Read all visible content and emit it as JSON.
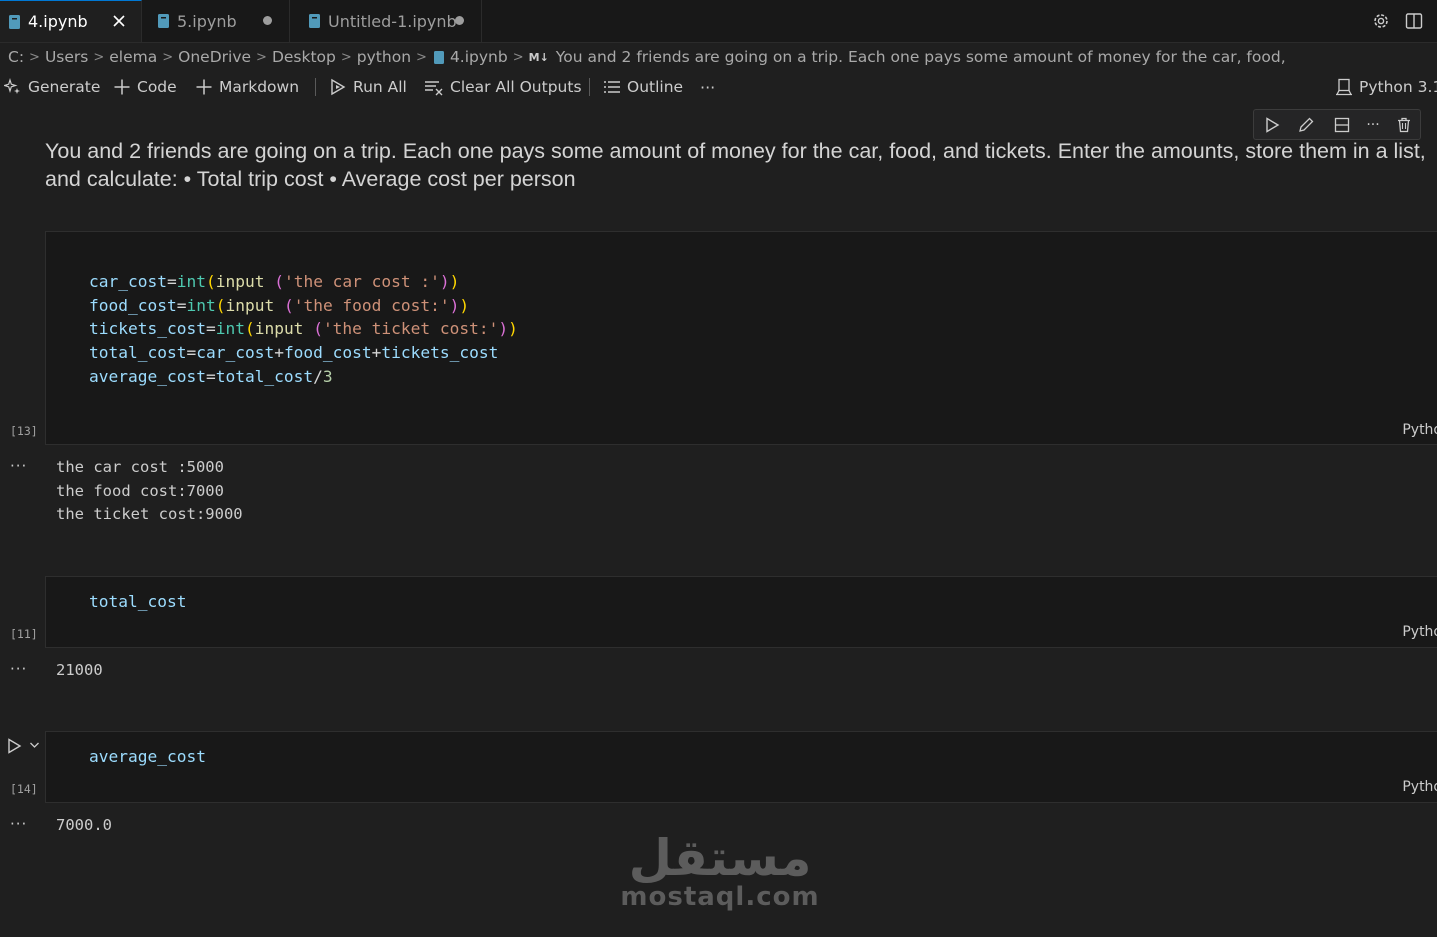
{
  "tabs": [
    {
      "label": "4.ipynb",
      "active": true
    },
    {
      "label": "5.ipynb",
      "dirty": true
    },
    {
      "label": "Untitled-1.ipynb",
      "dirty": true
    }
  ],
  "breadcrumb": [
    "C:",
    "Users",
    "elema",
    "OneDrive",
    "Desktop",
    "python",
    "4.ipynb",
    "You and 2 friends are going on a trip. Each one pays some amount of money for the car, food,"
  ],
  "breadcrumb_md_badge": "M↓",
  "toolbar": {
    "generate": "Generate",
    "code": "Code",
    "markdown": "Markdown",
    "run_all": "Run All",
    "clear_outputs": "Clear All Outputs",
    "outline": "Outline",
    "more": "···",
    "kernel": "Python 3.1"
  },
  "markdown_cell": {
    "text": "You and 2 friends are going on a trip. Each one pays some amount of money for the car, food, and tickets. Enter the amounts, store them in a list, and calculate: • Total trip cost • Average cost per person"
  },
  "cells": [
    {
      "exec_count": "[13]",
      "language": "Pytho",
      "code": [
        "car_cost=int(input ('the car cost :'))",
        "food_cost=int(input ('the food cost:'))",
        "tickets_cost=int(input ('the ticket cost:'))",
        "total_cost=car_cost+food_cost+tickets_cost",
        "average_cost=total_cost/3"
      ],
      "output": [
        "the car cost :5000",
        "the food cost:7000",
        "the ticket cost:9000"
      ]
    },
    {
      "exec_count": "[11]",
      "language": "Pytho",
      "code": [
        "total_cost"
      ],
      "output": [
        "21000"
      ]
    },
    {
      "exec_count": "[14]",
      "language": "Pytho",
      "code": [
        "average_cost"
      ],
      "output": [
        "7000.0"
      ]
    }
  ],
  "output_ellipsis": "···",
  "watermark": {
    "arabic": "مستقل",
    "latin": "mostaql.com"
  },
  "colors": {
    "accent": "#0078d4",
    "background": "#1f1f1f",
    "cell_bg": "#181818"
  }
}
